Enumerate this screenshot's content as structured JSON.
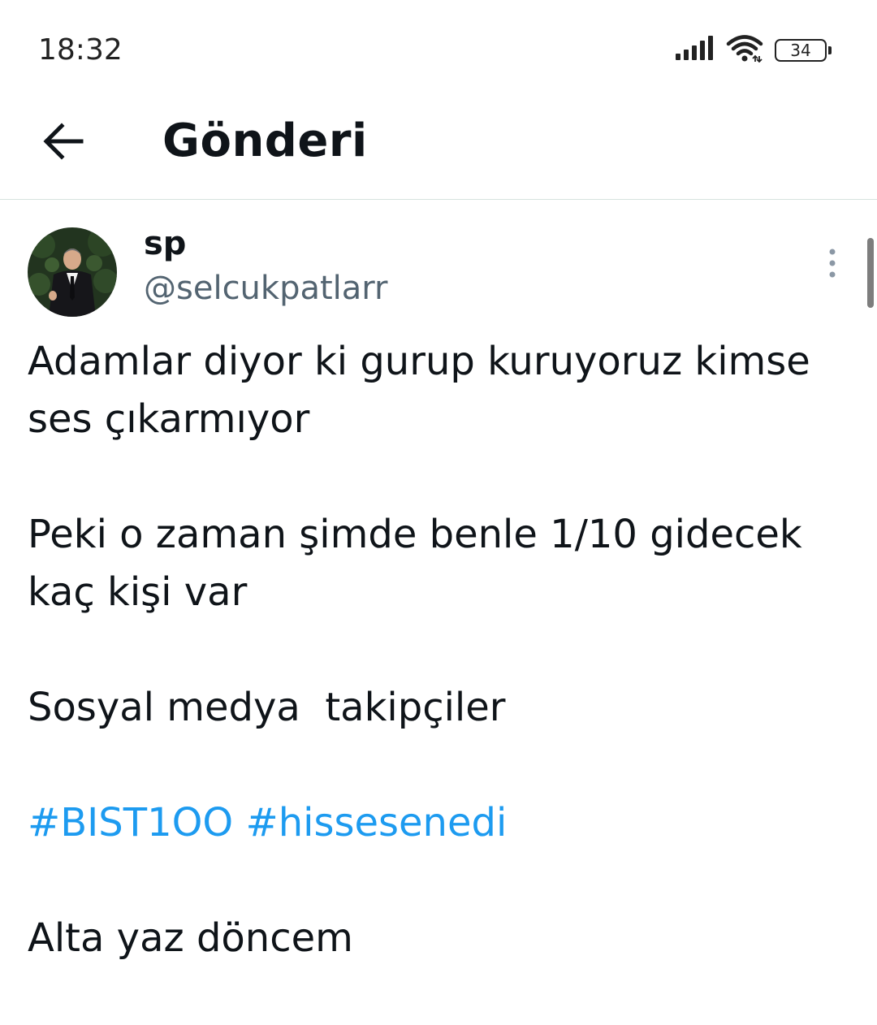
{
  "status_bar": {
    "time": "18:32",
    "battery_level": "34",
    "icons": [
      "signal-icon",
      "wifi-icon",
      "battery-icon"
    ]
  },
  "header": {
    "title": "Gönderi",
    "back_icon": "arrow-left-icon"
  },
  "post": {
    "author": {
      "name": "sp",
      "handle": "@selcukpatlarr"
    },
    "more_icon": "more-vertical-icon",
    "paragraphs": {
      "p1": "Adamlar diyor ki gurup kuruyoruz kimse ses çıkarmıyor",
      "p2": "Peki o zaman şimde benle 1/10 gidecek kaç kişi var",
      "p3": "Sosyal medya  takipçiler",
      "p5": "Alta yaz döncem"
    },
    "hashtags": {
      "first": "#BIST1OO",
      "second": "#hissesenedi"
    }
  },
  "colors": {
    "text": "#0f1419",
    "secondary_text": "#536471",
    "link": "#1d9bf0",
    "divider": "#d6e2de"
  }
}
